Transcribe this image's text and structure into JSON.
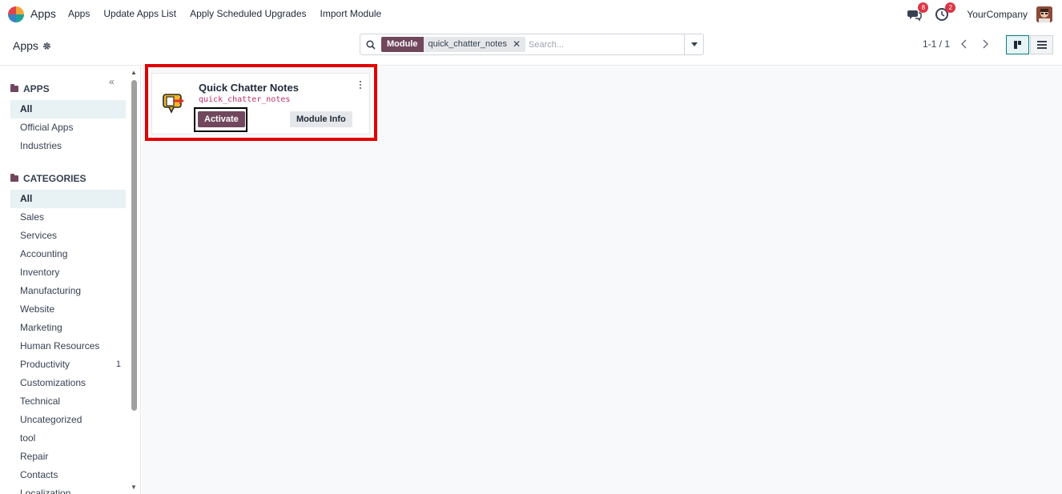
{
  "navbar": {
    "brand": "Apps",
    "menu": [
      "Apps",
      "Update Apps List",
      "Apply Scheduled Upgrades",
      "Import Module"
    ],
    "messages_badge": "8",
    "activity_badge": "2",
    "company": "YourCompany",
    "icons": [
      "apps-logo-icon",
      "chat-icon",
      "clock-icon",
      "avatar"
    ]
  },
  "control": {
    "breadcrumb": "Apps",
    "facet_name": "Module",
    "facet_value": "quick_chatter_notes",
    "search_placeholder": "Search...",
    "pager": "1-1 / 1"
  },
  "sidebar": {
    "apps_title": "APPS",
    "apps_items": [
      {
        "label": "All",
        "active": true
      },
      {
        "label": "Official Apps"
      },
      {
        "label": "Industries"
      }
    ],
    "categories_title": "CATEGORIES",
    "categories_items": [
      {
        "label": "All",
        "active": true
      },
      {
        "label": "Sales"
      },
      {
        "label": "Services"
      },
      {
        "label": "Accounting"
      },
      {
        "label": "Inventory"
      },
      {
        "label": "Manufacturing"
      },
      {
        "label": "Website"
      },
      {
        "label": "Marketing"
      },
      {
        "label": "Human Resources"
      },
      {
        "label": "Productivity",
        "count": "1"
      },
      {
        "label": "Customizations"
      },
      {
        "label": "Technical"
      },
      {
        "label": "Uncategorized"
      },
      {
        "label": "tool"
      },
      {
        "label": "Repair"
      },
      {
        "label": "Contacts"
      },
      {
        "label": "Localization"
      }
    ]
  },
  "card": {
    "title": "Quick Chatter Notes",
    "technical_name": "quick_chatter_notes",
    "activate_label": "Activate",
    "info_label": "Module Info"
  },
  "colors": {
    "primary": "#71475e",
    "badge": "#dc3545",
    "highlight": "#e00000",
    "tech_name": "#c0306c"
  }
}
